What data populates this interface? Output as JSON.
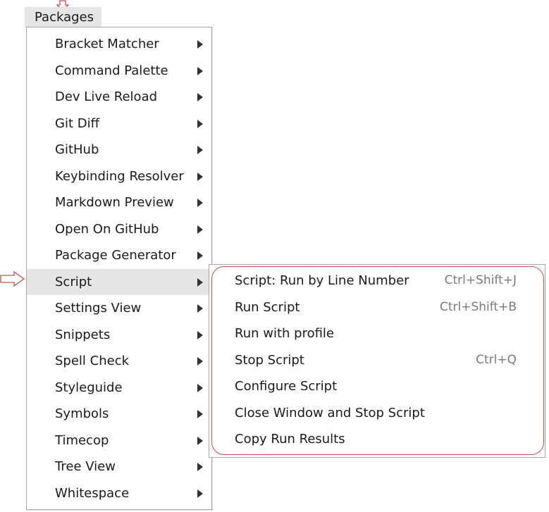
{
  "menubar": {
    "packages_label": "Packages"
  },
  "menu": {
    "items": [
      {
        "label": "Bracket Matcher"
      },
      {
        "label": "Command Palette"
      },
      {
        "label": "Dev Live Reload"
      },
      {
        "label": "Git Diff"
      },
      {
        "label": "GitHub"
      },
      {
        "label": "Keybinding Resolver"
      },
      {
        "label": "Markdown Preview"
      },
      {
        "label": "Open On GitHub"
      },
      {
        "label": "Package Generator"
      },
      {
        "label": "Script"
      },
      {
        "label": "Settings View"
      },
      {
        "label": "Snippets"
      },
      {
        "label": "Spell Check"
      },
      {
        "label": "Styleguide"
      },
      {
        "label": "Symbols"
      },
      {
        "label": "Timecop"
      },
      {
        "label": "Tree View"
      },
      {
        "label": "Whitespace"
      }
    ]
  },
  "submenu": {
    "items": [
      {
        "label": "Script: Run by Line Number",
        "shortcut": "Ctrl+Shift+J"
      },
      {
        "label": "Run Script",
        "shortcut": "Ctrl+Shift+B"
      },
      {
        "label": "Run with profile",
        "shortcut": ""
      },
      {
        "label": "Stop Script",
        "shortcut": "Ctrl+Q"
      },
      {
        "label": "Configure Script",
        "shortcut": ""
      },
      {
        "label": "Close Window and Stop Script",
        "shortcut": ""
      },
      {
        "label": "Copy Run Results",
        "shortcut": ""
      }
    ]
  },
  "colors": {
    "annotation": "#c0504d",
    "hover_bg": "#e6e6e6"
  }
}
